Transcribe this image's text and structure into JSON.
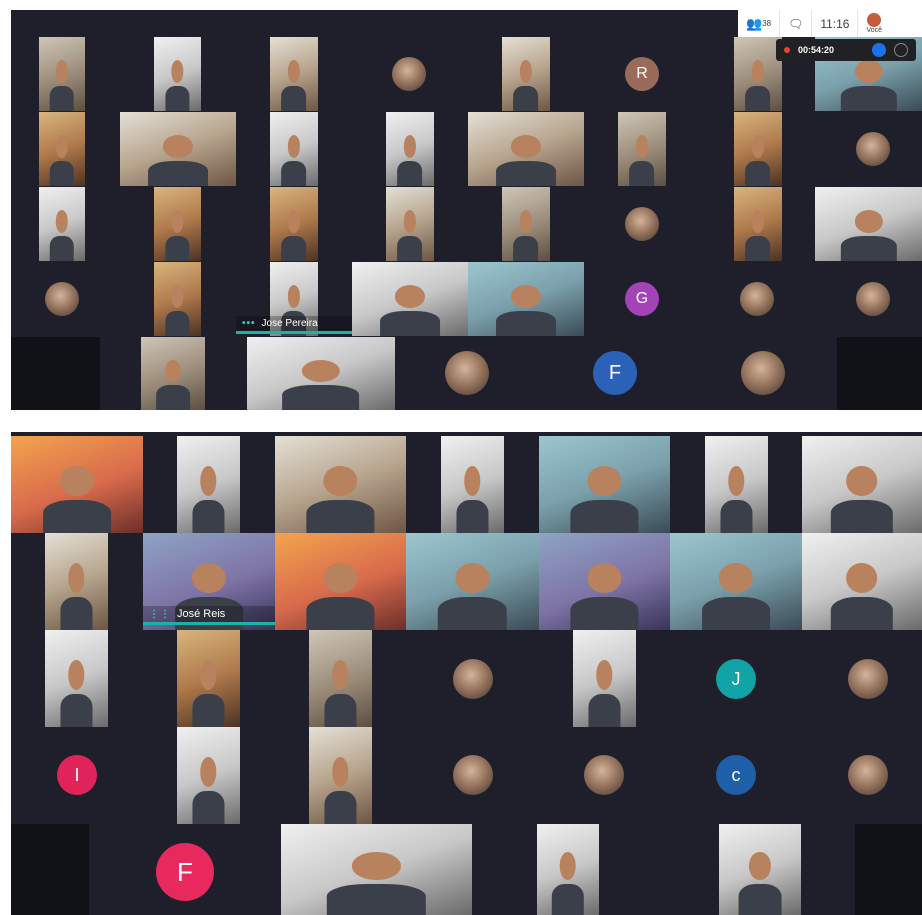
{
  "top_meeting": {
    "participant_count": "38",
    "clock": "11:16",
    "self_label": "Você",
    "recording_timer": "00:54:20",
    "name_tag": "Jose Pereira",
    "avatar_letters": [
      "R",
      "G",
      "F"
    ]
  },
  "bottom_meeting": {
    "name_tag": "José Reis",
    "avatar_letters": [
      "J",
      "I",
      "c",
      "F"
    ]
  },
  "colors": {
    "background": "#1e1f2b",
    "avatar_r": "#9a6b5a",
    "avatar_g": "#a442b8",
    "avatar_f_blue": "#2b62b8",
    "avatar_j": "#11a3a5",
    "avatar_i": "#e0245a",
    "avatar_c": "#1f5ea8",
    "avatar_f_pink": "#e8295e",
    "speaking": "#1bb3a7",
    "recording": "#ea4335"
  },
  "icons": {
    "participants": "people-icon",
    "chat": "chat-icon",
    "recording": "record-dot-icon",
    "stop": "stop-icon",
    "mic": "mic-off-icon"
  }
}
